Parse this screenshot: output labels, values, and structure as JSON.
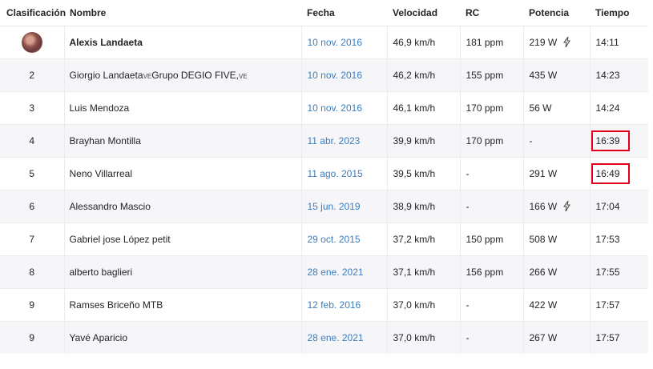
{
  "headers": {
    "rank": "Clasificación",
    "name": "Nombre",
    "date": "Fecha",
    "speed": "Velocidad",
    "hr": "RC",
    "power": "Potencia",
    "time": "Tiempo"
  },
  "rows": [
    {
      "rank": "",
      "name": "Alexis Landaeta",
      "date": "10 nov. 2016",
      "speed": "46,9 km/h",
      "hr": "181 ppm",
      "power": "219 W",
      "time": "14:11"
    },
    {
      "rank": "2",
      "name": "Giorgio Landaeta",
      "badge1": "VE",
      "club": "Grupo DEGIO FIVE,",
      "badge2": "VE",
      "date": "10 nov. 2016",
      "speed": "46,2 km/h",
      "hr": "155 ppm",
      "power": "435 W",
      "time": "14:23"
    },
    {
      "rank": "3",
      "name": "Luis Mendoza",
      "date": "10 nov. 2016",
      "speed": "46,1 km/h",
      "hr": "170 ppm",
      "power": "56 W",
      "time": "14:24"
    },
    {
      "rank": "4",
      "name": "Brayhan Montilla",
      "date": "11 abr. 2023",
      "speed": "39,9 km/h",
      "hr": "170 ppm",
      "power": "-",
      "time": "16:39"
    },
    {
      "rank": "5",
      "name": "Neno Villarreal",
      "date": "11 ago. 2015",
      "speed": "39,5 km/h",
      "hr": "-",
      "power": "291 W",
      "time": "16:49"
    },
    {
      "rank": "6",
      "name": "Alessandro Mascio",
      "date": "15 jun. 2019",
      "speed": "38,9 km/h",
      "hr": "-",
      "power": "166 W",
      "time": "17:04"
    },
    {
      "rank": "7",
      "name": "Gabriel jose López petit",
      "date": "29 oct. 2015",
      "speed": "37,2 km/h",
      "hr": "150 ppm",
      "power": "508 W",
      "time": "17:53"
    },
    {
      "rank": "8",
      "name": "alberto baglieri",
      "date": "28 ene. 2021",
      "speed": "37,1 km/h",
      "hr": "156 ppm",
      "power": "266 W",
      "time": "17:55"
    },
    {
      "rank": "9",
      "name": "Ramses Briceño MTB",
      "date": "12 feb. 2016",
      "speed": "37,0 km/h",
      "hr": "-",
      "power": "422 W",
      "time": "17:57"
    },
    {
      "rank": "9",
      "name": "Yavé Aparicio",
      "date": "28 ene. 2021",
      "speed": "37,0 km/h",
      "hr": "-",
      "power": "267 W",
      "time": "17:57"
    }
  ],
  "colors": {
    "date_link": "#3b7dbf",
    "highlight": "#e0001b",
    "stripe": "#f6f6f8"
  },
  "icons": {
    "row1_rank": "athlete-avatar",
    "power_meter": "lightning-bolt-icon"
  }
}
